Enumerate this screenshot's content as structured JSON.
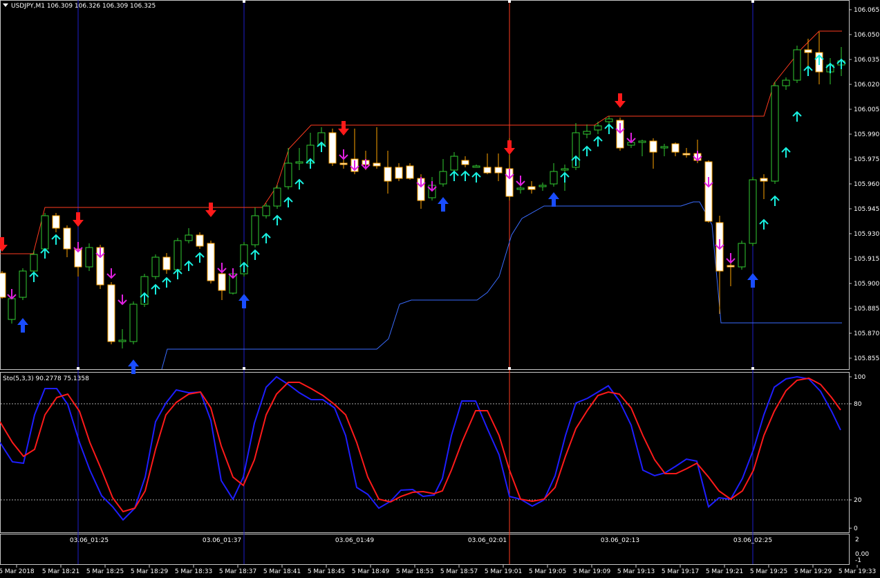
{
  "price_chart": {
    "header": "USDJPY,M1  106.309 106.326 106.309 106.325",
    "header_icon": "triangle-down-icon",
    "y_ticks": [
      "106.065",
      "106.050",
      "106.035",
      "106.020",
      "106.005",
      "105.990",
      "105.975",
      "105.960",
      "105.945",
      "105.930",
      "105.915",
      "105.900",
      "105.885",
      "105.870",
      "105.855"
    ]
  },
  "stochastic": {
    "header": "Sto(5,3,3) 90.2778 75.1358",
    "y_ticks": [
      "100",
      "80",
      "20",
      "0"
    ]
  },
  "extra_panel": {
    "y_ticks": [
      "2",
      "0.00",
      "-1"
    ]
  },
  "time_axis": {
    "labels": [
      "5 Mar 2018",
      "5 Mar 18:21",
      "5 Mar 18:25",
      "5 Mar 18:29",
      "5 Mar 18:33",
      "5 Mar 18:37",
      "5 Mar 18:41",
      "5 Mar 18:45",
      "5 Mar 18:49",
      "5 Mar 18:53",
      "5 Mar 18:57",
      "5 Mar 19:01",
      "5 Mar 19:05",
      "5 Mar 19:09",
      "5 Mar 19:13",
      "5 Mar 19:17",
      "5 Mar 19:21",
      "5 Mar 19:25",
      "5 Mar 19:29",
      "5 Mar 19:33"
    ]
  },
  "separators": {
    "labels": [
      "03.06_01:25",
      "03.06_01:37",
      "03.06_01:49",
      "03.06_02:01",
      "03.06_02:13",
      "03.06_02:25"
    ]
  },
  "colors": {
    "background": "#000000",
    "bull_candle": "#32cd32",
    "bear_candle_body": "#ffffff",
    "wick_alt": "#ffa500",
    "upper_channel": "#ff3b1f",
    "lower_channel": "#3a6cff",
    "stoch_main": "#1e1eff",
    "stoch_signal": "#ff1a1a",
    "separator_blue": "#1e1ecc",
    "separator_red": "#ff3b1f",
    "arrow_up_cyan": "#19f0e0",
    "arrow_down_magenta": "#e020e0",
    "arrow_up_blue": "#1a4dff",
    "arrow_down_red": "#ff1a1a"
  }
}
